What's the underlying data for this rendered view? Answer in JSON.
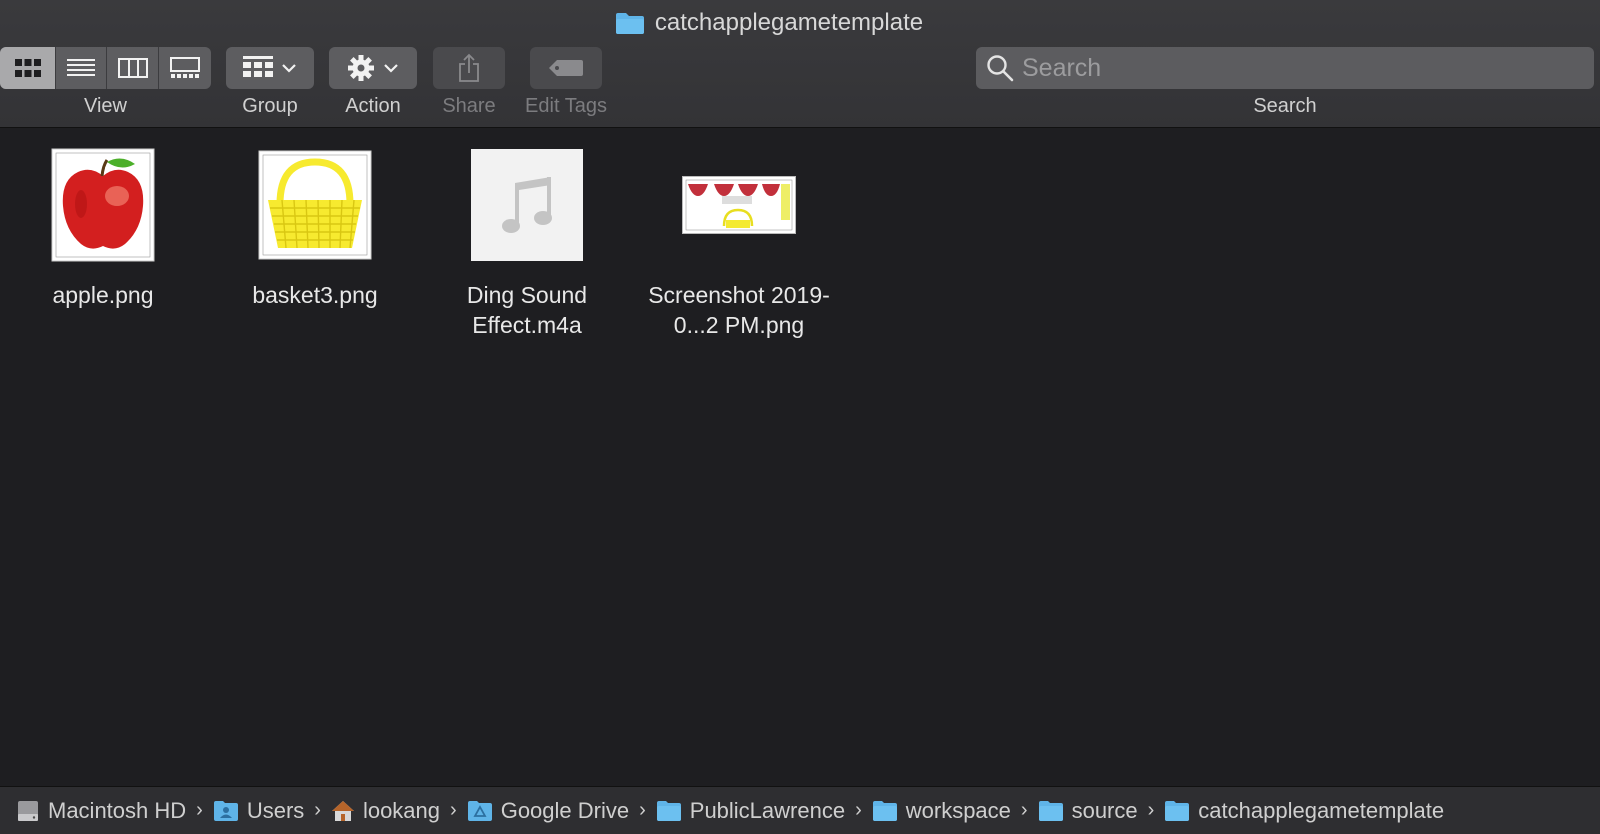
{
  "window": {
    "title": "catchapplegametemplate"
  },
  "toolbar": {
    "view_label": "View",
    "group_label": "Group",
    "action_label": "Action",
    "share_label": "Share",
    "edit_tags_label": "Edit Tags",
    "search_label": "Search",
    "search_placeholder": "Search",
    "view_modes": [
      "icon-view",
      "list-view",
      "column-view",
      "gallery-view"
    ],
    "active_view": "icon-view"
  },
  "files": [
    {
      "name": "apple.png",
      "kind": "image-apple"
    },
    {
      "name": "basket3.png",
      "kind": "image-basket"
    },
    {
      "name": "Ding Sound Effect.m4a",
      "kind": "audio"
    },
    {
      "name": "Screenshot 2019-0...2 PM.png",
      "kind": "image-screenshot"
    }
  ],
  "path": [
    {
      "label": "Macintosh HD",
      "icon": "hard-drive-icon"
    },
    {
      "label": "Users",
      "icon": "users-folder-icon"
    },
    {
      "label": "lookang",
      "icon": "home-icon"
    },
    {
      "label": "Google Drive",
      "icon": "google-drive-folder-icon"
    },
    {
      "label": "PublicLawrence",
      "icon": "folder-icon"
    },
    {
      "label": "workspace",
      "icon": "folder-icon"
    },
    {
      "label": "source",
      "icon": "folder-icon"
    },
    {
      "label": "catchapplegametemplate",
      "icon": "folder-icon"
    }
  ],
  "colors": {
    "toolbar": "#363639",
    "content": "#1e1e21",
    "folder_blue": "#5fb4e8",
    "apple_red": "#d31f1f",
    "basket_yellow": "#f7ea2f"
  }
}
